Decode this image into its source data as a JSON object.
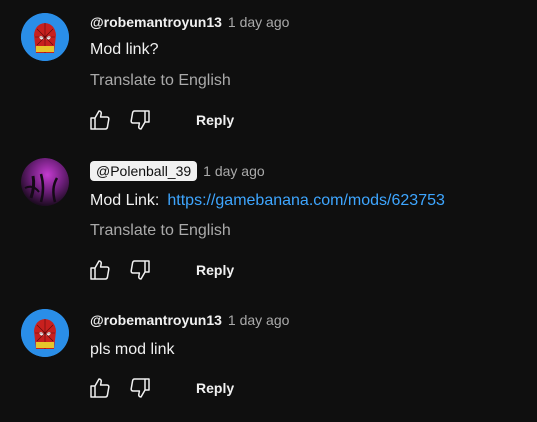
{
  "comments": [
    {
      "author": "@robemantroyun13",
      "time": "1 day ago",
      "text": "Mod link?",
      "translate": "Translate to English",
      "reply_label": "Reply",
      "avatar_icon": "spiderman-avatar"
    },
    {
      "author": "@Polenball_39",
      "time": "1 day ago",
      "text_label": "Mod Link:",
      "link": "https://gamebanana.com/mods/623753",
      "translate": "Translate to English",
      "reply_label": "Reply",
      "avatar_icon": "purple-tentacle-avatar"
    },
    {
      "author": "@robemantroyun13",
      "time": "1 day ago",
      "text": "pls mod link",
      "reply_label": "Reply",
      "avatar_icon": "spiderman-avatar"
    }
  ],
  "colors": {
    "background": "#0f0f0f",
    "link": "#3ea6ff",
    "secondary_text": "#aaaaaa"
  }
}
